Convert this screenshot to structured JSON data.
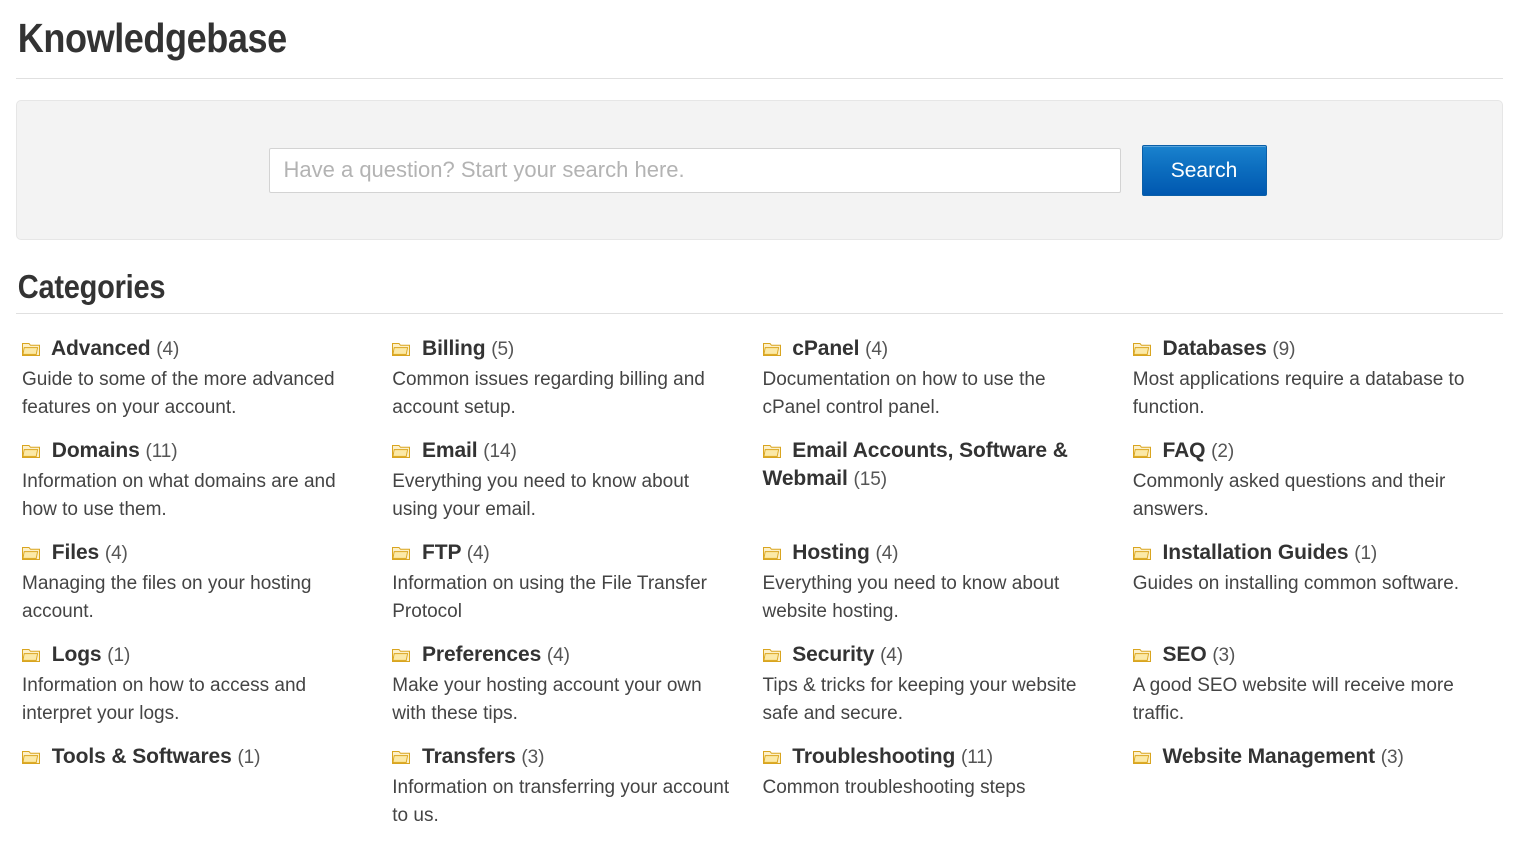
{
  "page": {
    "title": "Knowledgebase",
    "section_title": "Categories"
  },
  "search": {
    "placeholder": "Have a question? Start your search here.",
    "value": "",
    "button_label": "Search"
  },
  "colors": {
    "accent_button_top": "#1a82ce",
    "accent_button_bottom": "#0058b0",
    "folder_icon": "#f0c24a",
    "heading_text": "#333333",
    "body_text": "#444444",
    "panel_bg": "#f3f3f3",
    "rule": "#e0e0e0"
  },
  "categories": [
    {
      "icon": "folder-icon",
      "name": "Advanced",
      "count": "(4)",
      "description": "Guide to some of the more advanced features on your account."
    },
    {
      "icon": "folder-icon",
      "name": "Billing",
      "count": "(5)",
      "description": "Common issues regarding billing and account setup."
    },
    {
      "icon": "folder-icon",
      "name": "cPanel",
      "count": "(4)",
      "description": "Documentation on how to use the cPanel control panel."
    },
    {
      "icon": "folder-icon",
      "name": "Databases",
      "count": "(9)",
      "description": "Most applications require a database to function."
    },
    {
      "icon": "folder-icon",
      "name": "Domains",
      "count": "(11)",
      "description": "Information on what domains are and how to use them."
    },
    {
      "icon": "folder-icon",
      "name": "Email",
      "count": "(14)",
      "description": "Everything you need to know about using your email."
    },
    {
      "icon": "folder-icon",
      "name": "Email Accounts, Software & Webmail",
      "count": "(15)",
      "description": ""
    },
    {
      "icon": "folder-icon",
      "name": "FAQ",
      "count": "(2)",
      "description": "Commonly asked questions and their answers."
    },
    {
      "icon": "folder-icon",
      "name": "Files",
      "count": "(4)",
      "description": "Managing the files on your hosting account."
    },
    {
      "icon": "folder-icon",
      "name": "FTP",
      "count": "(4)",
      "description": "Information on using the File Transfer Protocol"
    },
    {
      "icon": "folder-icon",
      "name": "Hosting",
      "count": "(4)",
      "description": "Everything you need to know about website hosting."
    },
    {
      "icon": "folder-icon",
      "name": "Installation Guides",
      "count": "(1)",
      "description": "Guides on installing common software."
    },
    {
      "icon": "folder-icon",
      "name": "Logs",
      "count": "(1)",
      "description": "Information on how to access and interpret your logs."
    },
    {
      "icon": "folder-icon",
      "name": "Preferences",
      "count": "(4)",
      "description": "Make your hosting account your own with these tips."
    },
    {
      "icon": "folder-icon",
      "name": "Security",
      "count": "(4)",
      "description": "Tips & tricks for keeping your website safe and secure."
    },
    {
      "icon": "folder-icon",
      "name": "SEO",
      "count": "(3)",
      "description": "A good SEO website will receive more traffic."
    },
    {
      "icon": "folder-icon",
      "name": "Tools & Softwares",
      "count": "(1)",
      "description": ""
    },
    {
      "icon": "folder-icon",
      "name": "Transfers",
      "count": "(3)",
      "description": "Information on transferring your account to us."
    },
    {
      "icon": "folder-icon",
      "name": "Troubleshooting",
      "count": "(11)",
      "description": "Common troubleshooting steps"
    },
    {
      "icon": "folder-icon",
      "name": "Website Management",
      "count": "(3)",
      "description": ""
    }
  ]
}
